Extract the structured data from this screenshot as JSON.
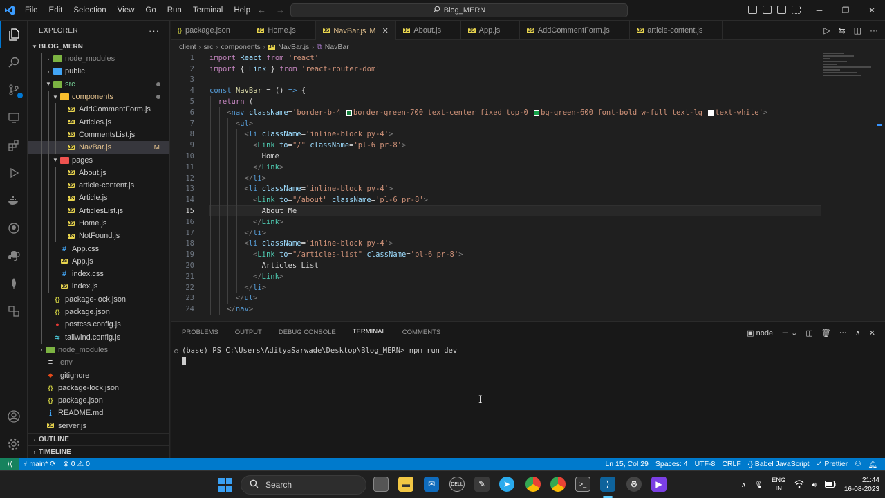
{
  "titlebar": {
    "menu": [
      "File",
      "Edit",
      "Selection",
      "View",
      "Go",
      "Run",
      "Terminal",
      "Help"
    ],
    "search_text": "Blog_MERN"
  },
  "explorer": {
    "header": "EXPLORER",
    "root": "BLOG_MERN",
    "items": [
      {
        "label": "node_modules",
        "indent": 2,
        "type": "folder-green",
        "chev": "right",
        "dim": true
      },
      {
        "label": "public",
        "indent": 2,
        "type": "folder-blue",
        "chev": "right"
      },
      {
        "label": "src",
        "indent": 2,
        "type": "folder-green",
        "chev": "down",
        "dot": true,
        "color": "green"
      },
      {
        "label": "components",
        "indent": 3,
        "type": "folder-yellow",
        "chev": "down",
        "dot": true,
        "color": "modified"
      },
      {
        "label": "AddCommentForm.js",
        "indent": 4,
        "type": "js"
      },
      {
        "label": "Articles.js",
        "indent": 4,
        "type": "js"
      },
      {
        "label": "CommentsList.js",
        "indent": 4,
        "type": "js"
      },
      {
        "label": "NavBar.js",
        "indent": 4,
        "type": "js",
        "selected": true,
        "badge": "M",
        "color": "modified"
      },
      {
        "label": "pages",
        "indent": 3,
        "type": "folder-red",
        "chev": "down"
      },
      {
        "label": "About.js",
        "indent": 4,
        "type": "js"
      },
      {
        "label": "article-content.js",
        "indent": 4,
        "type": "js"
      },
      {
        "label": "Article.js",
        "indent": 4,
        "type": "js"
      },
      {
        "label": "ArticlesList.js",
        "indent": 4,
        "type": "js"
      },
      {
        "label": "Home.js",
        "indent": 4,
        "type": "js"
      },
      {
        "label": "NotFound.js",
        "indent": 4,
        "type": "js"
      },
      {
        "label": "App.css",
        "indent": 3,
        "type": "css"
      },
      {
        "label": "App.js",
        "indent": 3,
        "type": "js"
      },
      {
        "label": "index.css",
        "indent": 3,
        "type": "css"
      },
      {
        "label": "index.js",
        "indent": 3,
        "type": "js"
      },
      {
        "label": "package-lock.json",
        "indent": 2,
        "type": "json"
      },
      {
        "label": "package.json",
        "indent": 2,
        "type": "json"
      },
      {
        "label": "postcss.config.js",
        "indent": 2,
        "type": "cfg"
      },
      {
        "label": "tailwind.config.js",
        "indent": 2,
        "type": "tw"
      },
      {
        "label": "node_modules",
        "indent": 1,
        "type": "folder-green",
        "chev": "right",
        "dim": true
      },
      {
        "label": ".env",
        "indent": 1,
        "type": "env",
        "dim": true
      },
      {
        "label": ".gitignore",
        "indent": 1,
        "type": "git"
      },
      {
        "label": "package-lock.json",
        "indent": 1,
        "type": "json"
      },
      {
        "label": "package.json",
        "indent": 1,
        "type": "json"
      },
      {
        "label": "README.md",
        "indent": 1,
        "type": "md"
      },
      {
        "label": "server.js",
        "indent": 1,
        "type": "js"
      }
    ],
    "outline": "OUTLINE",
    "timeline": "TIMELINE"
  },
  "tabs": [
    {
      "label": "package.json",
      "icon": "json"
    },
    {
      "label": "Home.js",
      "icon": "js"
    },
    {
      "label": "NavBar.js",
      "icon": "js",
      "active": true,
      "suffix": "M"
    },
    {
      "label": "About.js",
      "icon": "js"
    },
    {
      "label": "App.js",
      "icon": "js"
    },
    {
      "label": "AddCommentForm.js",
      "icon": "js"
    },
    {
      "label": "article-content.js",
      "icon": "js"
    }
  ],
  "breadcrumb": [
    "client",
    "src",
    "components",
    "NavBar.js",
    "NavBar"
  ],
  "editor": {
    "current_line": 15,
    "lines": [
      {
        "n": 1,
        "indent": 0,
        "tokens": [
          [
            "kw",
            "import"
          ],
          [
            "txt",
            " "
          ],
          [
            "ident",
            "React"
          ],
          [
            "txt",
            " "
          ],
          [
            "kw",
            "from"
          ],
          [
            "txt",
            " "
          ],
          [
            "str",
            "'react'"
          ]
        ]
      },
      {
        "n": 2,
        "indent": 0,
        "tokens": [
          [
            "kw",
            "import"
          ],
          [
            "txt",
            " { "
          ],
          [
            "ident",
            "Link"
          ],
          [
            "txt",
            " } "
          ],
          [
            "kw",
            "from"
          ],
          [
            "txt",
            " "
          ],
          [
            "str",
            "'react-router-dom'"
          ]
        ]
      },
      {
        "n": 3,
        "indent": 0,
        "tokens": []
      },
      {
        "n": 4,
        "indent": 0,
        "tokens": [
          [
            "kw2",
            "const"
          ],
          [
            "txt",
            " "
          ],
          [
            "fn",
            "NavBar"
          ],
          [
            "txt",
            " = () "
          ],
          [
            "kw2",
            "=>"
          ],
          [
            "txt",
            " {"
          ]
        ]
      },
      {
        "n": 5,
        "indent": 1,
        "tokens": [
          [
            "kw",
            "return"
          ],
          [
            "txt",
            " ("
          ]
        ]
      },
      {
        "n": 6,
        "indent": 2,
        "tokens": [
          [
            "punct",
            "<"
          ],
          [
            "tag",
            "nav"
          ],
          [
            "txt",
            " "
          ],
          [
            "attr",
            "className"
          ],
          [
            "txt",
            "="
          ],
          [
            "str",
            "'border-b-4 "
          ],
          [
            "swatch",
            "#15803d"
          ],
          [
            "str",
            "border-green-700 text-center fixed top-0 "
          ],
          [
            "swatch",
            "#16a34a"
          ],
          [
            "str",
            "bg-green-600 font-bold w-full text-lg "
          ],
          [
            "swatch",
            "#ffffff"
          ],
          [
            "str",
            "text-white'"
          ],
          [
            "punct",
            ">"
          ]
        ]
      },
      {
        "n": 7,
        "indent": 3,
        "tokens": [
          [
            "punct",
            "<"
          ],
          [
            "tag",
            "ul"
          ],
          [
            "punct",
            ">"
          ]
        ]
      },
      {
        "n": 8,
        "indent": 4,
        "tokens": [
          [
            "punct",
            "<"
          ],
          [
            "tag",
            "li"
          ],
          [
            "txt",
            " "
          ],
          [
            "attr",
            "className"
          ],
          [
            "txt",
            "="
          ],
          [
            "str",
            "'inline-block py-4'"
          ],
          [
            "punct",
            ">"
          ]
        ]
      },
      {
        "n": 9,
        "indent": 5,
        "tokens": [
          [
            "punct",
            "<"
          ],
          [
            "comp",
            "Link"
          ],
          [
            "txt",
            " "
          ],
          [
            "attr",
            "to"
          ],
          [
            "txt",
            "="
          ],
          [
            "str",
            "\"/\""
          ],
          [
            "txt",
            " "
          ],
          [
            "attr",
            "className"
          ],
          [
            "txt",
            "="
          ],
          [
            "str",
            "'pl-6 pr-8'"
          ],
          [
            "punct",
            ">"
          ]
        ]
      },
      {
        "n": 10,
        "indent": 6,
        "tokens": [
          [
            "txt",
            "Home"
          ]
        ]
      },
      {
        "n": 11,
        "indent": 5,
        "tokens": [
          [
            "punct",
            "</"
          ],
          [
            "comp",
            "Link"
          ],
          [
            "punct",
            ">"
          ]
        ]
      },
      {
        "n": 12,
        "indent": 4,
        "tokens": [
          [
            "punct",
            "</"
          ],
          [
            "tag",
            "li"
          ],
          [
            "punct",
            ">"
          ]
        ]
      },
      {
        "n": 13,
        "indent": 4,
        "tokens": [
          [
            "punct",
            "<"
          ],
          [
            "tag",
            "li"
          ],
          [
            "txt",
            " "
          ],
          [
            "attr",
            "className"
          ],
          [
            "txt",
            "="
          ],
          [
            "str",
            "'inline-block py-4'"
          ],
          [
            "punct",
            ">"
          ]
        ]
      },
      {
        "n": 14,
        "indent": 5,
        "tokens": [
          [
            "punct",
            "<"
          ],
          [
            "comp",
            "Link"
          ],
          [
            "txt",
            " "
          ],
          [
            "attr",
            "to"
          ],
          [
            "txt",
            "="
          ],
          [
            "str",
            "\"/about\""
          ],
          [
            "txt",
            " "
          ],
          [
            "attr",
            "className"
          ],
          [
            "txt",
            "="
          ],
          [
            "str",
            "'pl-6 pr-8'"
          ],
          [
            "punct",
            ">"
          ]
        ]
      },
      {
        "n": 15,
        "indent": 6,
        "tokens": [
          [
            "txt",
            "About Me"
          ]
        ]
      },
      {
        "n": 16,
        "indent": 5,
        "tokens": [
          [
            "punct",
            "</"
          ],
          [
            "comp",
            "Link"
          ],
          [
            "punct",
            ">"
          ]
        ]
      },
      {
        "n": 17,
        "indent": 4,
        "tokens": [
          [
            "punct",
            "</"
          ],
          [
            "tag",
            "li"
          ],
          [
            "punct",
            ">"
          ]
        ]
      },
      {
        "n": 18,
        "indent": 4,
        "tokens": [
          [
            "punct",
            "<"
          ],
          [
            "tag",
            "li"
          ],
          [
            "txt",
            " "
          ],
          [
            "attr",
            "className"
          ],
          [
            "txt",
            "="
          ],
          [
            "str",
            "'inline-block py-4'"
          ],
          [
            "punct",
            ">"
          ]
        ]
      },
      {
        "n": 19,
        "indent": 5,
        "tokens": [
          [
            "punct",
            "<"
          ],
          [
            "comp",
            "Link"
          ],
          [
            "txt",
            " "
          ],
          [
            "attr",
            "to"
          ],
          [
            "txt",
            "="
          ],
          [
            "str",
            "\"/articles-list\""
          ],
          [
            "txt",
            " "
          ],
          [
            "attr",
            "className"
          ],
          [
            "txt",
            "="
          ],
          [
            "str",
            "'pl-6 pr-8'"
          ],
          [
            "punct",
            ">"
          ]
        ]
      },
      {
        "n": 20,
        "indent": 6,
        "tokens": [
          [
            "txt",
            "Articles List"
          ]
        ]
      },
      {
        "n": 21,
        "indent": 5,
        "tokens": [
          [
            "punct",
            "</"
          ],
          [
            "comp",
            "Link"
          ],
          [
            "punct",
            ">"
          ]
        ]
      },
      {
        "n": 22,
        "indent": 4,
        "tokens": [
          [
            "punct",
            "</"
          ],
          [
            "tag",
            "li"
          ],
          [
            "punct",
            ">"
          ]
        ]
      },
      {
        "n": 23,
        "indent": 3,
        "tokens": [
          [
            "punct",
            "</"
          ],
          [
            "tag",
            "ul"
          ],
          [
            "punct",
            ">"
          ]
        ]
      },
      {
        "n": 24,
        "indent": 2,
        "tokens": [
          [
            "punct",
            "</"
          ],
          [
            "tag",
            "nav"
          ],
          [
            "punct",
            ">"
          ]
        ]
      }
    ]
  },
  "panel": {
    "tabs": [
      "PROBLEMS",
      "OUTPUT",
      "DEBUG CONSOLE",
      "TERMINAL",
      "COMMENTS"
    ],
    "active_tab": "TERMINAL",
    "terminal_name": "node",
    "prompt_line": "(base) PS C:\\Users\\AdityaSarwade\\Desktop\\Blog_MERN> npm run dev"
  },
  "statusbar": {
    "branch": "main*",
    "errors": "0",
    "warnings": "0",
    "position": "Ln 15, Col 29",
    "spaces": "Spaces: 4",
    "encoding": "UTF-8",
    "eol": "CRLF",
    "language": "Babel JavaScript",
    "formatter": "Prettier"
  },
  "taskbar": {
    "search_label": "Search",
    "lang_top": "ENG",
    "lang_bottom": "IN",
    "time": "21:44",
    "date": "16-08-2023"
  },
  "colors": {
    "accent": "#007acc",
    "remote": "#16825d",
    "modified": "#e2c08d"
  }
}
